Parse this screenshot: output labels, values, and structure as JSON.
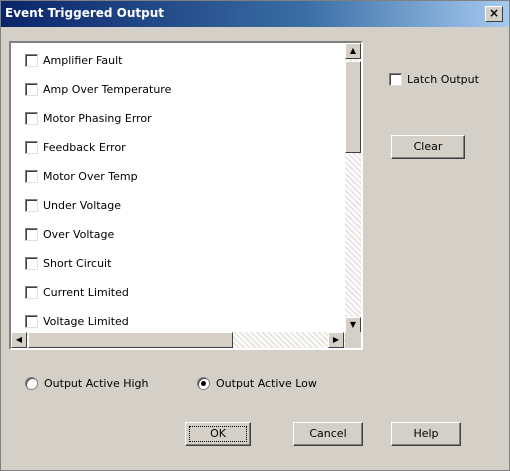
{
  "window": {
    "title": "Event Triggered Output",
    "close_glyph": "×"
  },
  "list": {
    "items": [
      {
        "label": "Amplifier Fault",
        "checked": false
      },
      {
        "label": "Amp Over Temperature",
        "checked": false
      },
      {
        "label": "Motor Phasing Error",
        "checked": false
      },
      {
        "label": "Feedback Error",
        "checked": false
      },
      {
        "label": "Motor Over Temp",
        "checked": false
      },
      {
        "label": "Under Voltage",
        "checked": false
      },
      {
        "label": "Over Voltage",
        "checked": false
      },
      {
        "label": "Short Circuit",
        "checked": false
      },
      {
        "label": "Current Limited",
        "checked": false
      },
      {
        "label": "Voltage Limited",
        "checked": false
      }
    ],
    "scroll_up_glyph": "▲",
    "scroll_down_glyph": "▼",
    "scroll_left_glyph": "◀",
    "scroll_right_glyph": "▶"
  },
  "latch": {
    "label": "Latch Output",
    "checked": false
  },
  "clear_button": "Clear",
  "radios": {
    "high_label": "Output Active High",
    "low_label": "Output Active Low",
    "selected": "low"
  },
  "buttons": {
    "ok": "OK",
    "cancel": "Cancel",
    "help": "Help"
  }
}
